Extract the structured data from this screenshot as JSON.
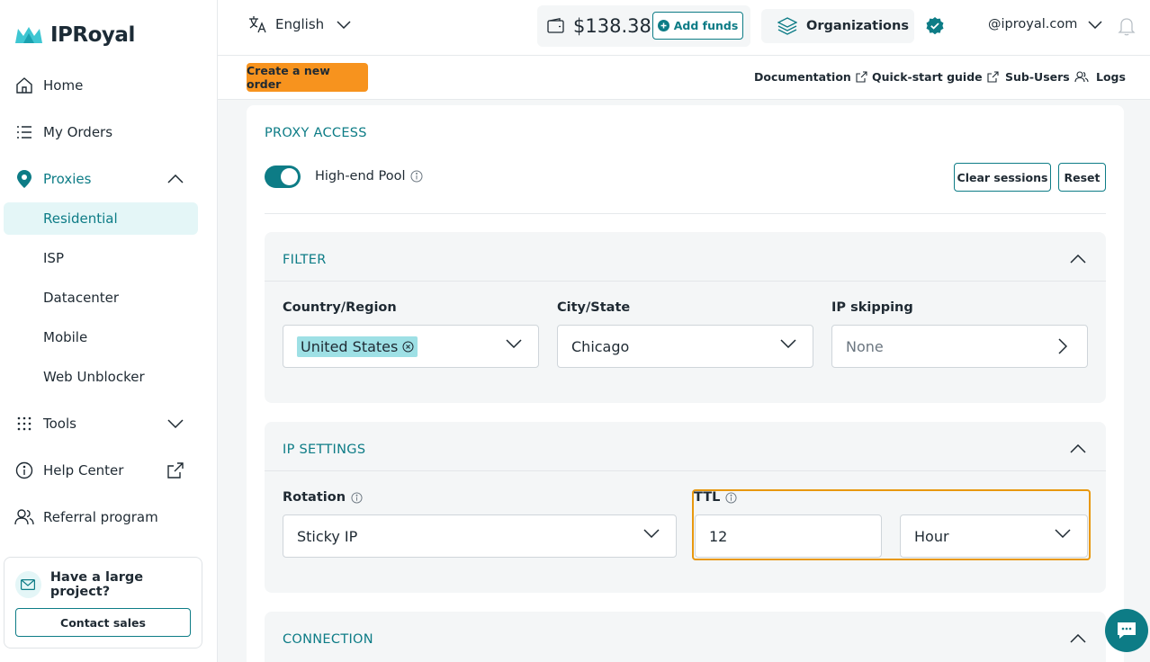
{
  "brand": {
    "name": "IPRoyal"
  },
  "sidebar": {
    "items": [
      {
        "label": "Home"
      },
      {
        "label": "My Orders"
      },
      {
        "label": "Proxies"
      },
      {
        "label": "Tools"
      },
      {
        "label": "Help Center"
      },
      {
        "label": "Referral program"
      }
    ],
    "proxy_subitems": [
      "Residential",
      "ISP",
      "Datacenter",
      "Mobile",
      "Web Unblocker"
    ],
    "promo": {
      "title": "Have a large project?",
      "button": "Contact sales"
    }
  },
  "topbar": {
    "language": "English",
    "balance": "$138.38",
    "add_funds": "Add funds",
    "organizations": "Organizations",
    "account": "@iproyal.com"
  },
  "subbar": {
    "create_order": "Create a new order",
    "links": [
      "Documentation",
      "Quick-start guide",
      "Sub-Users",
      "Logs"
    ]
  },
  "proxy_access": {
    "title": "PROXY ACCESS",
    "pool_label": "High-end Pool",
    "pool_enabled": true,
    "clear_sessions": "Clear sessions",
    "reset": "Reset"
  },
  "filter": {
    "title": "FILTER",
    "country_label": "Country/Region",
    "country_value": "United States",
    "city_label": "City/State",
    "city_value": "Chicago",
    "ip_skipping_label": "IP skipping",
    "ip_skipping_placeholder": "None"
  },
  "ip_settings": {
    "title": "IP SETTINGS",
    "rotation_label": "Rotation",
    "rotation_value": "Sticky IP",
    "ttl_label": "TTL",
    "ttl_value": "12",
    "ttl_unit": "Hour"
  },
  "connection": {
    "title": "CONNECTION"
  },
  "colors": {
    "accent": "#0d7c86",
    "order_button": "#f7931e",
    "highlight": "#e8980f",
    "chip": "#9ee0e5"
  }
}
